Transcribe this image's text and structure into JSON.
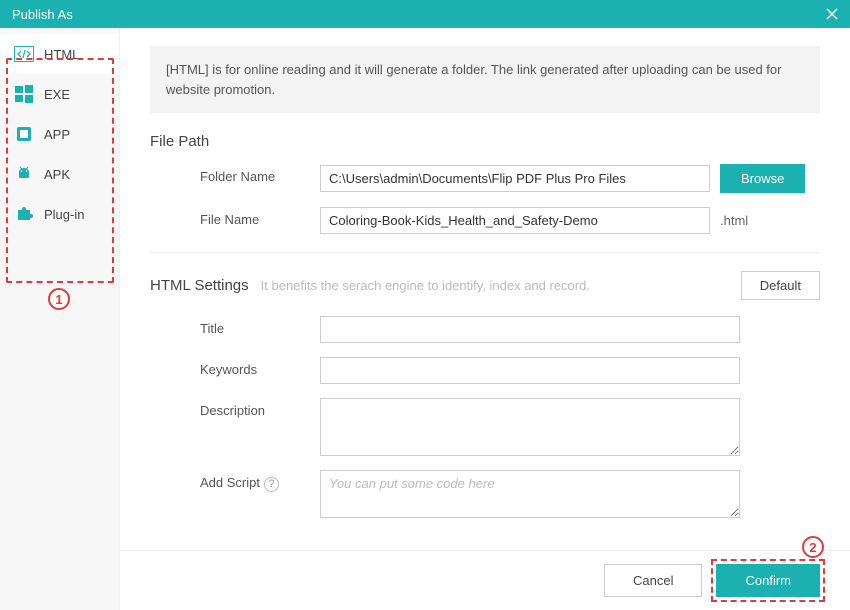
{
  "window": {
    "title": "Publish As"
  },
  "sidebar": {
    "items": [
      {
        "label": "HTML"
      },
      {
        "label": "EXE"
      },
      {
        "label": "APP"
      },
      {
        "label": "APK"
      },
      {
        "label": "Plug-in"
      }
    ]
  },
  "info_text": "[HTML] is for online reading and it will generate a folder. The link generated after uploading can be used for website promotion.",
  "filepath": {
    "heading": "File Path",
    "folder_label": "Folder Name",
    "folder_value": "C:\\Users\\admin\\Documents\\Flip PDF Plus Pro Files",
    "browse_label": "Browse",
    "file_label": "File Name",
    "file_value": "Coloring-Book-Kids_Health_and_Safety-Demo",
    "file_ext": ".html"
  },
  "settings": {
    "heading": "HTML Settings",
    "hint": "It benefits the serach engine to identify, index and record.",
    "default_label": "Default",
    "title_label": "Title",
    "title_value": "",
    "keywords_label": "Keywords",
    "keywords_value": "",
    "description_label": "Description",
    "description_value": "",
    "script_label": "Add Script",
    "script_placeholder": "You can put some code here",
    "script_value": ""
  },
  "footer": {
    "cancel": "Cancel",
    "confirm": "Confirm"
  },
  "annotations": {
    "one": "1",
    "two": "2"
  },
  "colors": {
    "accent": "#1bb1b1",
    "annotation": "#e03b3b"
  }
}
